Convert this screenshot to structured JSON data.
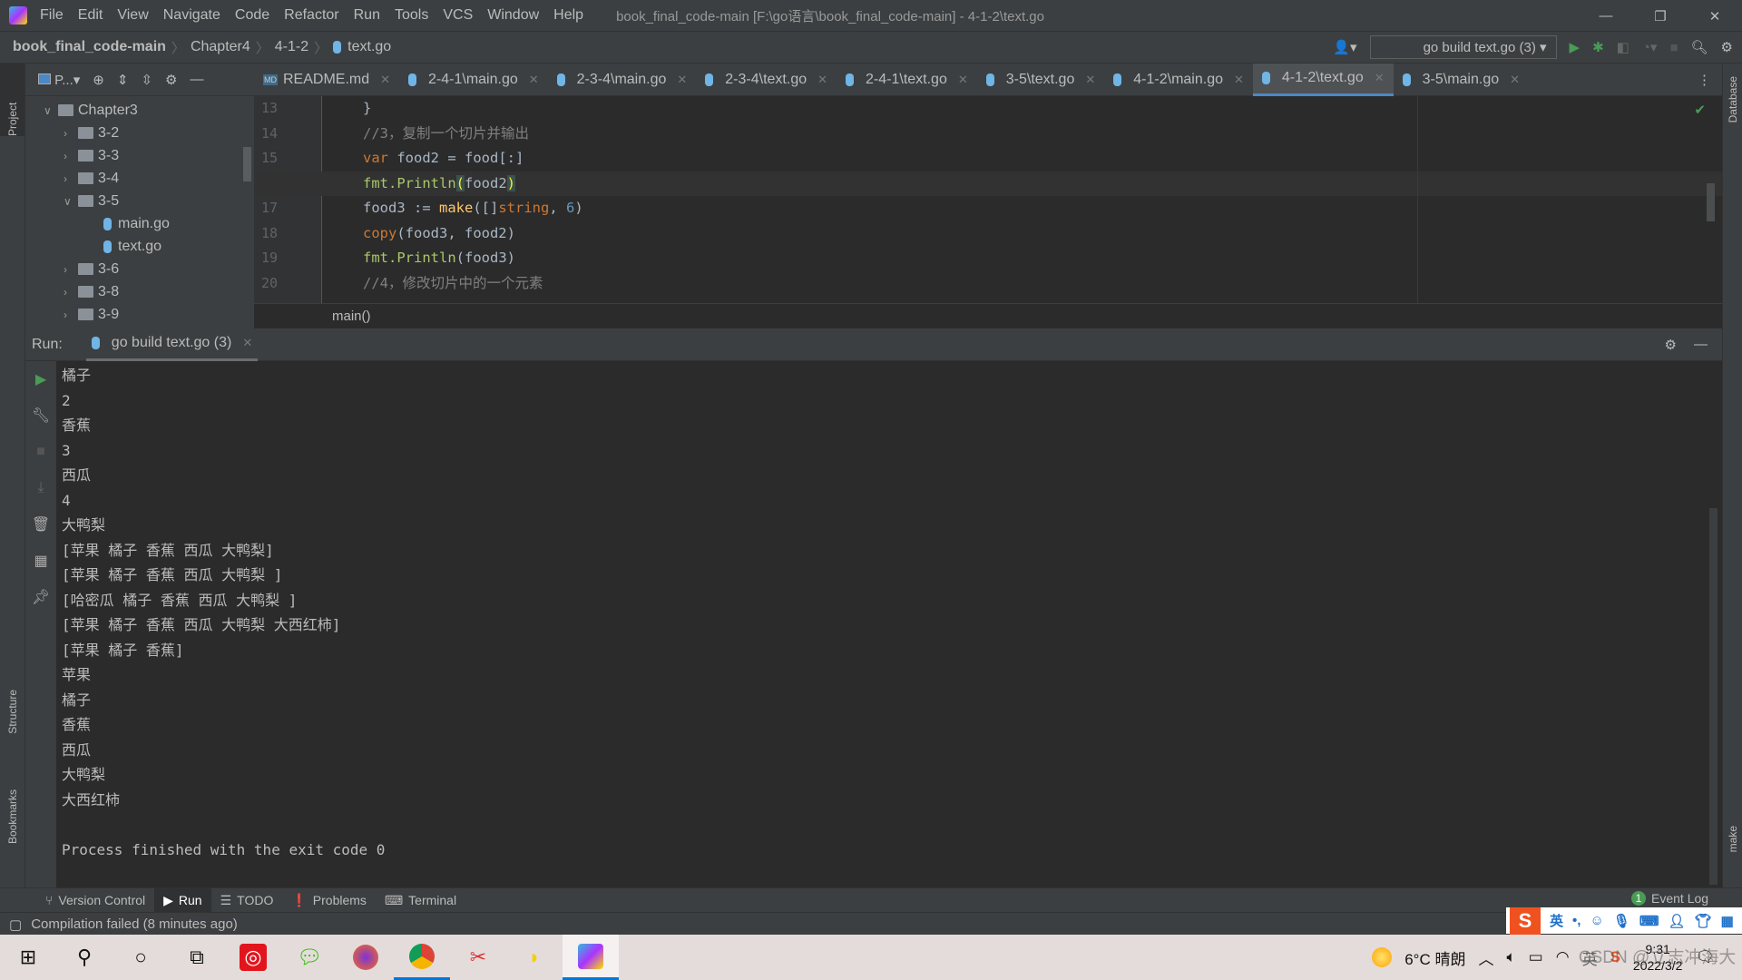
{
  "window": {
    "title": "book_final_code-main [F:\\go语言\\book_final_code-main] - 4-1-2\\text.go"
  },
  "menu": [
    "File",
    "Edit",
    "View",
    "Navigate",
    "Code",
    "Refactor",
    "Run",
    "Tools",
    "VCS",
    "Window",
    "Help"
  ],
  "breadcrumb": [
    "book_final_code-main",
    "Chapter4",
    "4-1-2",
    "text.go"
  ],
  "run_config": "go build text.go (3)",
  "project": {
    "label": "P...",
    "strip_label": "Project",
    "tree": [
      {
        "label": "Chapter3",
        "type": "folder",
        "depth": 0,
        "expanded": true
      },
      {
        "label": "3-2",
        "type": "folder",
        "depth": 1
      },
      {
        "label": "3-3",
        "type": "folder",
        "depth": 1
      },
      {
        "label": "3-4",
        "type": "folder",
        "depth": 1
      },
      {
        "label": "3-5",
        "type": "folder",
        "depth": 1,
        "expanded": true
      },
      {
        "label": "main.go",
        "type": "file",
        "depth": 2
      },
      {
        "label": "text.go",
        "type": "file",
        "depth": 2
      },
      {
        "label": "3-6",
        "type": "folder",
        "depth": 1
      },
      {
        "label": "3-8",
        "type": "folder",
        "depth": 1
      },
      {
        "label": "3-9",
        "type": "folder",
        "depth": 1
      }
    ]
  },
  "tabs": [
    {
      "label": "README.md",
      "icon": "markdown-icon"
    },
    {
      "label": "2-4-1\\main.go"
    },
    {
      "label": "2-3-4\\main.go"
    },
    {
      "label": "2-3-4\\text.go"
    },
    {
      "label": "2-4-1\\text.go"
    },
    {
      "label": "3-5\\text.go"
    },
    {
      "label": "4-1-2\\main.go"
    },
    {
      "label": "4-1-2\\text.go",
      "active": true
    },
    {
      "label": "3-5\\main.go"
    }
  ],
  "editor": {
    "current_line": 16,
    "lines": [
      {
        "n": "13",
        "html": "}"
      },
      {
        "n": "14",
        "html": "<span class='cm'>//3，复制一个切片并输出</span>"
      },
      {
        "n": "15",
        "html": "<span class='kw'>var</span> food2 = food[:]"
      },
      {
        "n": "16",
        "html": "<span class='fn'>fmt.Println</span><span class='br'>(</span>food2<span class='br'>)</span>"
      },
      {
        "n": "17",
        "html": "food3 := <span class='bi'>make</span>([]<span class='kw'>string</span>, <span class='num'>6</span>)"
      },
      {
        "n": "18",
        "html": "<span class='kw'>copy</span>(food3, food2)"
      },
      {
        "n": "19",
        "html": "<span class='fn'>fmt.Println</span>(food3)"
      },
      {
        "n": "20",
        "html": "<span class='cm'>//4，修改切片中的一个元素</span>"
      }
    ],
    "breadcrumb": "main()"
  },
  "run": {
    "label": "Run:",
    "tab": "go build text.go (3)",
    "output": [
      "橘子",
      "2",
      "香蕉",
      "3",
      "西瓜",
      "4",
      "大鸭梨",
      "[苹果 橘子 香蕉 西瓜 大鸭梨]",
      "[苹果 橘子 香蕉 西瓜 大鸭梨 ]",
      "[哈密瓜 橘子 香蕉 西瓜 大鸭梨 ]",
      "[苹果 橘子 香蕉 西瓜 大鸭梨 大西红柿]",
      "[苹果 橘子 香蕉]",
      "苹果",
      "橘子",
      "香蕉",
      "西瓜",
      "大鸭梨",
      "大西红柿",
      "",
      "Process finished with the exit code 0"
    ]
  },
  "side_labels": {
    "structure": "Structure",
    "bookmarks": "Bookmarks",
    "database": "Database",
    "make": "make"
  },
  "bottom_tabs": [
    {
      "label": "Version Control"
    },
    {
      "label": "Run",
      "active": true
    },
    {
      "label": "TODO"
    },
    {
      "label": "Problems"
    },
    {
      "label": "Terminal"
    }
  ],
  "event_log": {
    "label": "Event Log",
    "count": "1"
  },
  "status": "Compilation failed (8 minutes ago)",
  "ime": {
    "lang": "英"
  },
  "taskbar": {
    "weather": "6°C 晴朗",
    "ime": "英",
    "time": "9:31",
    "date": "2022/3/2",
    "watermark": "CSDN @立志冲海大"
  },
  "colors": {
    "accent": "#4a88c7",
    "run_green": "#499c54"
  }
}
